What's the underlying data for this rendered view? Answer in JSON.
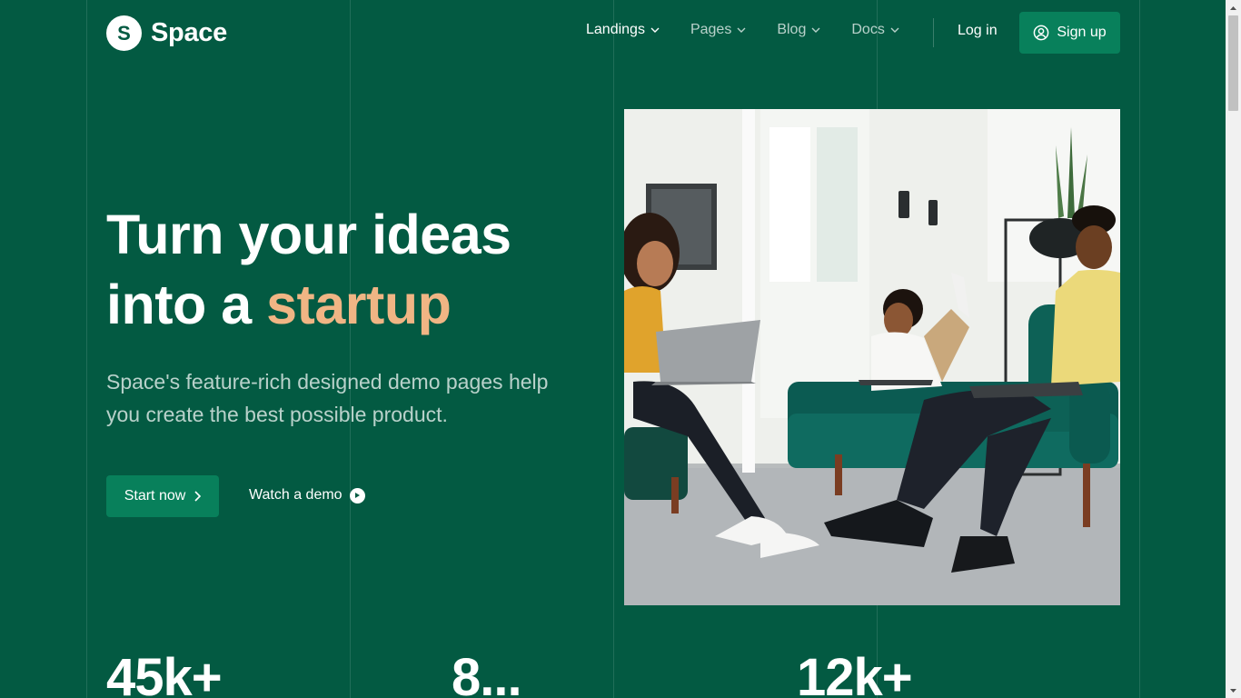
{
  "brand": {
    "mark": "S",
    "name": "Space"
  },
  "nav": {
    "items": [
      {
        "label": "Landings"
      },
      {
        "label": "Pages"
      },
      {
        "label": "Blog"
      },
      {
        "label": "Docs"
      }
    ],
    "login_label": "Log in",
    "signup_label": "Sign up"
  },
  "hero": {
    "title_line1": "Turn your ideas",
    "title_line2_prefix": "into a ",
    "title_highlight": "startup",
    "subtitle": "Space's feature-rich designed demo pages help you create the best possible product.",
    "primary_cta": "Start now",
    "secondary_cta": "Watch a demo"
  },
  "stats": [
    {
      "value": "45k+"
    },
    {
      "value": "8..."
    },
    {
      "value": "12k+"
    }
  ],
  "icons": {
    "brand": "brand-logo-icon",
    "dropdown": "chevron-down-icon",
    "signup": "user-circle-icon",
    "start": "chevron-right-icon",
    "demo": "play-circle-icon"
  },
  "colors": {
    "background": "#035a42",
    "button": "#08805b",
    "accent": "#f0b584"
  }
}
